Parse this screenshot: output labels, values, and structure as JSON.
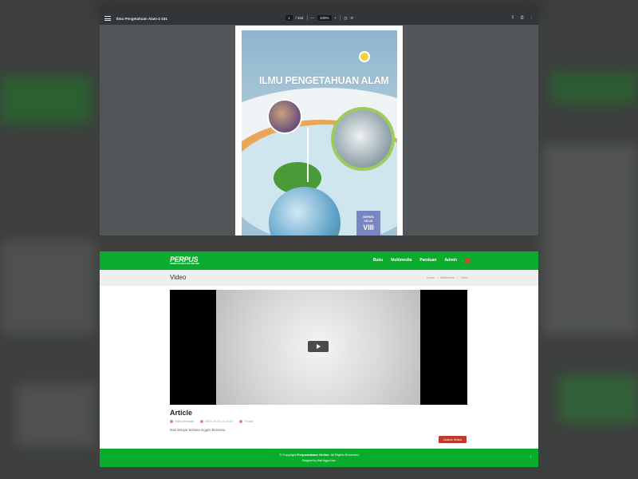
{
  "pdf_viewer": {
    "title": "Ilmu Pengetahuan Alam-1-151",
    "page_current": "1",
    "page_total": "/ 344",
    "zoom_out": "—",
    "zoom": "100%",
    "zoom_in": "+",
    "icons": [
      "menu-icon",
      "fit-page-icon",
      "rotate-icon",
      "download-icon",
      "print-icon",
      "more-icon"
    ]
  },
  "book_cover": {
    "title": "ILMU PENGETAHUAN ALAM",
    "badge_line1": "SMP/MTs",
    "badge_line2": "KELAS",
    "badge_grade": "VIII"
  },
  "site": {
    "brand": "PERPUS",
    "brand_sub": "PERPUSTAKAAN ONLINE",
    "nav": [
      "Buku",
      "Multimedia",
      "Panduan",
      "Admin"
    ],
    "page_title": "Video",
    "breadcrumb": [
      "Home",
      "/",
      "Multimedia",
      "/",
      "Video"
    ],
    "article_title": "Article",
    "meta_author": "Hilda Dirmada",
    "meta_date": "2022-04-25 11:19:21",
    "meta_views": "70 kali",
    "description": "Mari Belajar Bahasa Inggris Bersama",
    "download_label": "Unduh Video",
    "footer_copyright_prefix": "© Copyright ",
    "footer_copyright_name": "Perpustakaan Online",
    "footer_copyright_suffix": ". All Rights Reserved",
    "footer_designed": "Designed by Hobi Ngga Koen",
    "back_to_top": "↑"
  },
  "colors": {
    "brand_green": "#0aac2d",
    "download_red": "#c0392b",
    "pdf_toolbar": "#323639"
  }
}
